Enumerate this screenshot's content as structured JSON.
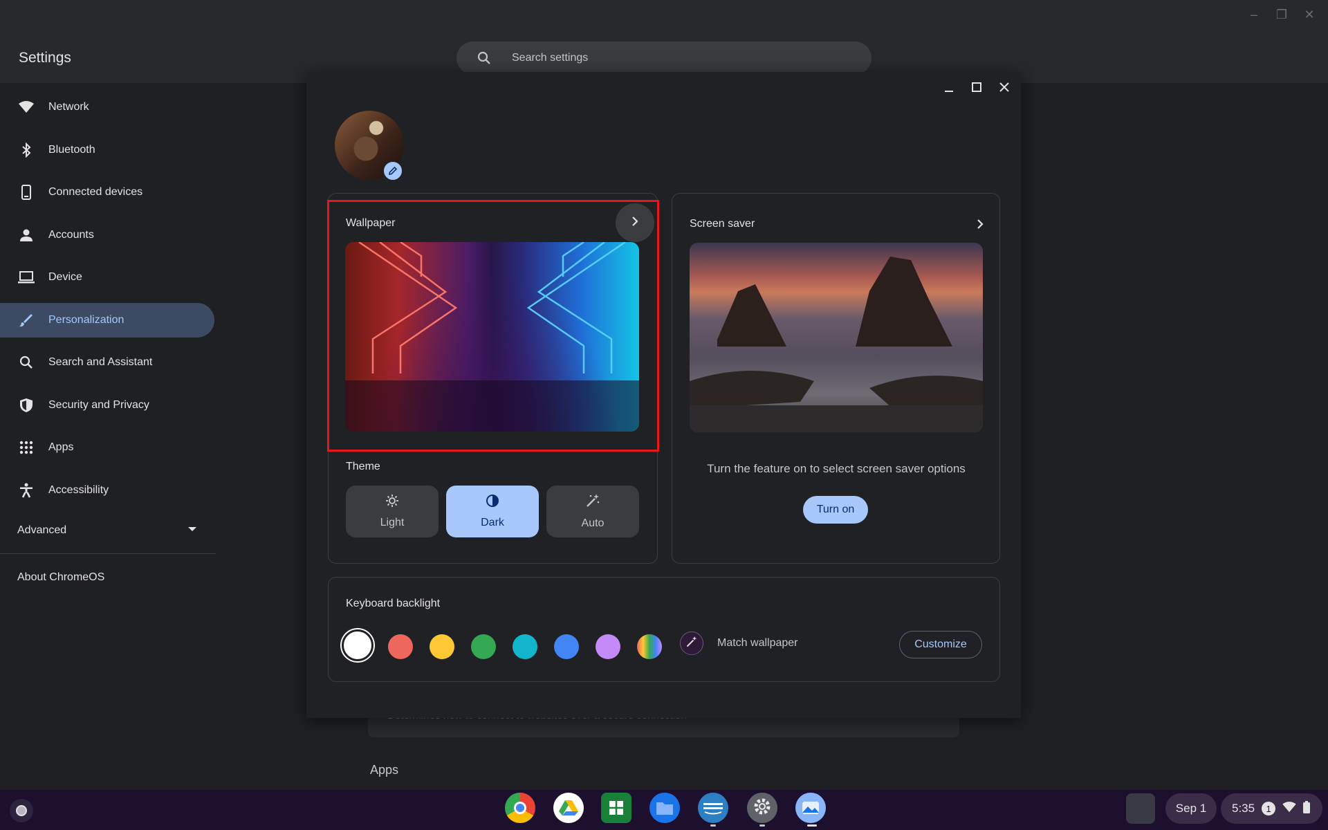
{
  "settings": {
    "title": "Settings",
    "search_placeholder": "Search settings",
    "nav": [
      {
        "label": "Network",
        "icon": "wifi-icon"
      },
      {
        "label": "Bluetooth",
        "icon": "bluetooth-icon"
      },
      {
        "label": "Connected devices",
        "icon": "phone-icon"
      },
      {
        "label": "Accounts",
        "icon": "person-icon"
      },
      {
        "label": "Device",
        "icon": "laptop-icon"
      },
      {
        "label": "Personalization",
        "icon": "brush-icon",
        "active": true
      },
      {
        "label": "Search and Assistant",
        "icon": "search-icon"
      },
      {
        "label": "Security and Privacy",
        "icon": "shield-icon"
      },
      {
        "label": "Apps",
        "icon": "apps-grid-icon"
      },
      {
        "label": "Accessibility",
        "icon": "accessibility-icon"
      }
    ],
    "advanced_label": "Advanced",
    "about_label": "About ChromeOS",
    "background_card_text": "Determines how to connect to websites over a secure connection",
    "background_section_title": "Apps"
  },
  "personalization": {
    "wallpaper": {
      "title": "Wallpaper"
    },
    "screen_saver": {
      "title": "Screen saver",
      "message": "Turn the feature on to select screen saver options",
      "button": "Turn on"
    },
    "theme": {
      "title": "Theme",
      "options": [
        {
          "label": "Light",
          "icon": "sun-icon",
          "selected": false
        },
        {
          "label": "Dark",
          "icon": "contrast-icon",
          "selected": true
        },
        {
          "label": "Auto",
          "icon": "magic-wand-icon",
          "selected": false
        }
      ]
    },
    "keyboard_backlight": {
      "title": "Keyboard backlight",
      "colors": [
        "#ffffff",
        "#ee675c",
        "#fcc934",
        "#34a853",
        "#12b5cb",
        "#4285f4",
        "#c58af9",
        "rainbow"
      ],
      "selected_color": "#ffffff",
      "match_label": "Match wallpaper",
      "customize_button": "Customize"
    }
  },
  "shelf": {
    "apps": [
      "Chrome",
      "Google Drive",
      "Google Sheets",
      "Files",
      "Prime Video",
      "Settings",
      "Wallpaper & style"
    ],
    "date": "Sep 1",
    "time": "5:35",
    "notification_count": "1"
  },
  "colors": {
    "accent": "#a8c7fa",
    "highlight": "#e8171b",
    "background": "#1f2023"
  }
}
